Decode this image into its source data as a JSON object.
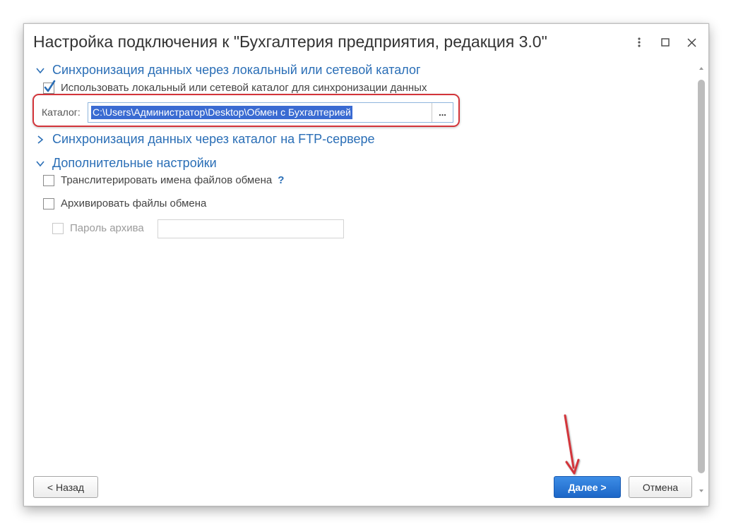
{
  "window": {
    "title": "Настройка подключения к \"Бухгалтерия предприятия, редакция 3.0\""
  },
  "sections": {
    "local": {
      "title": "Синхронизация данных через локальный или сетевой каталог",
      "expanded": true,
      "use_checkbox_label": "Использовать локальный или сетевой каталог для синхронизации данных",
      "use_checked": true,
      "catalog_label": "Каталог:",
      "catalog_value": "C:\\Users\\Администратор\\Desktop\\Обмен с Бухгалтерией",
      "browse_label": "..."
    },
    "ftp": {
      "title": "Синхронизация данных через каталог на FTP-сервере",
      "expanded": false
    },
    "extra": {
      "title": "Дополнительные настройки",
      "expanded": true,
      "transliterate_label": "Транслитерировать имена файлов обмена",
      "help_mark": "?",
      "archive_label": "Архивировать файлы обмена",
      "archive_password_label": "Пароль архива",
      "archive_password_value": ""
    }
  },
  "buttons": {
    "back": "< Назад",
    "next": "Далее >",
    "cancel": "Отмена"
  },
  "colors": {
    "accent_blue": "#2a6eb6",
    "primary_button": "#1c66c7",
    "highlight_red": "#d3343a",
    "selection": "#3a6bd2"
  },
  "icons": {
    "menu": "vertical-dots-icon",
    "maximize": "maximize-icon",
    "close": "close-icon",
    "expanded": "chevron-down-icon",
    "collapsed": "chevron-right-icon"
  }
}
